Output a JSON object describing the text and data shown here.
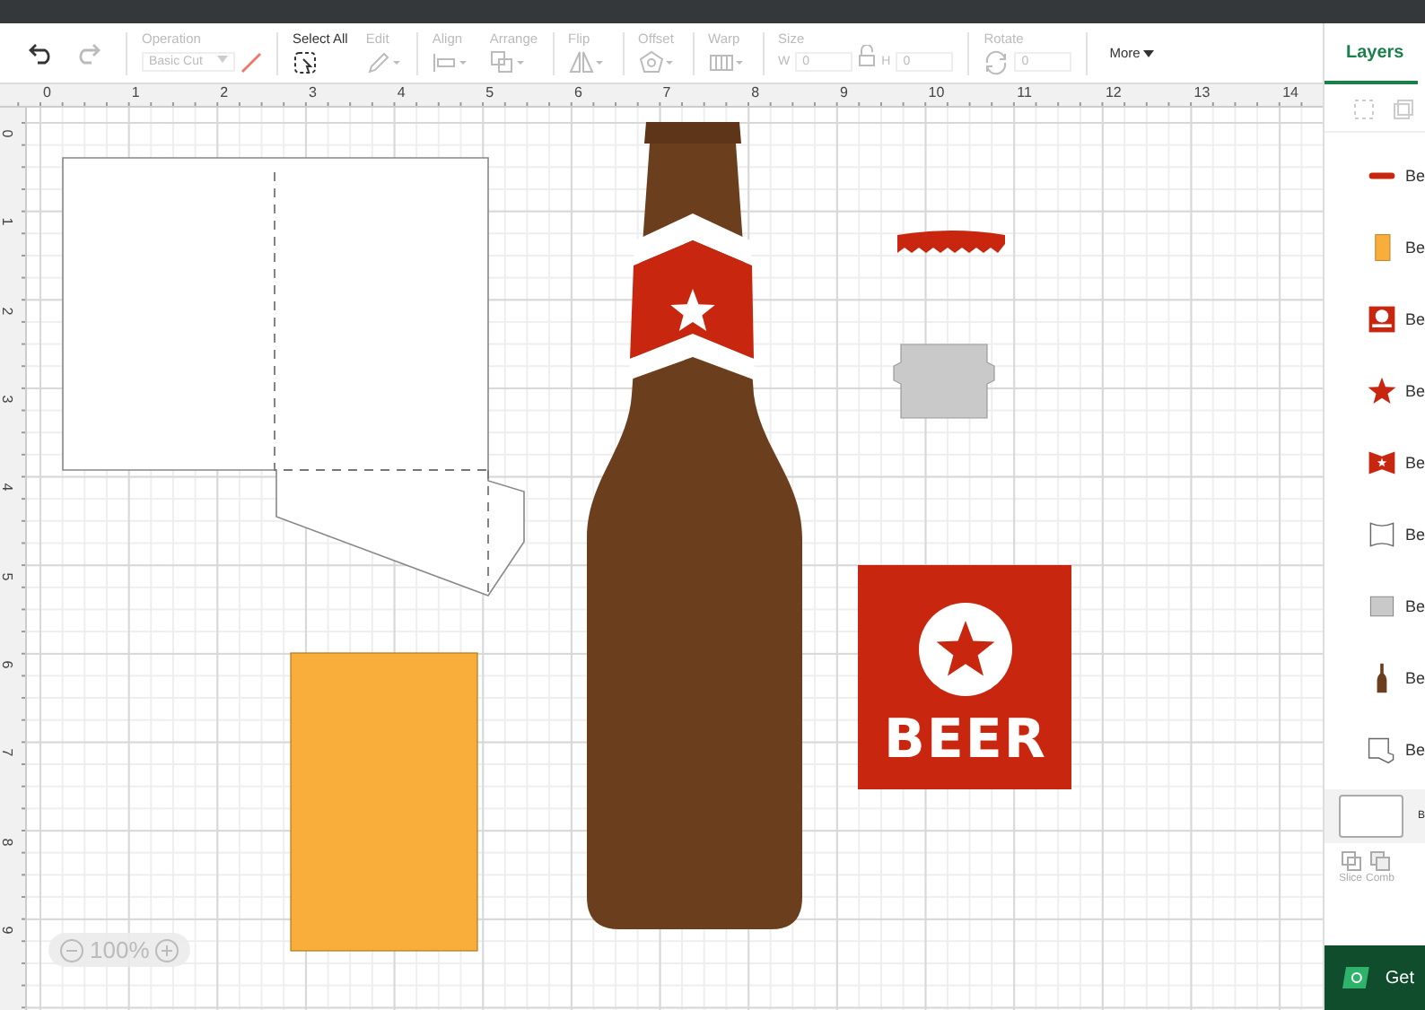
{
  "toolbar": {
    "undo": {
      "disabled": false
    },
    "redo": {
      "disabled": true
    },
    "sections": [
      [
        {
          "kind": "operation",
          "label": "Operation",
          "value": "Basic Cut",
          "disabled": true
        }
      ],
      [
        {
          "kind": "select-all",
          "label": "Select All",
          "disabled": false
        },
        {
          "kind": "edit",
          "label": "Edit",
          "disabled": true
        }
      ],
      [
        {
          "kind": "align",
          "label": "Align",
          "disabled": true
        },
        {
          "kind": "arrange",
          "label": "Arrange",
          "disabled": true
        }
      ],
      [
        {
          "kind": "flip",
          "label": "Flip",
          "disabled": true
        }
      ],
      [
        {
          "kind": "offset",
          "label": "Offset",
          "disabled": true
        }
      ],
      [
        {
          "kind": "warp",
          "label": "Warp",
          "disabled": true
        }
      ],
      [
        {
          "kind": "size",
          "label": "Size",
          "w_label": "W",
          "w_value": "0",
          "h_label": "H",
          "h_value": "0",
          "disabled": true
        }
      ],
      [
        {
          "kind": "rotate",
          "label": "Rotate",
          "value": "0",
          "disabled": true
        }
      ]
    ],
    "more": "More"
  },
  "ruler": {
    "x_labels": [
      "0",
      "1",
      "2",
      "3",
      "4",
      "5",
      "6",
      "7",
      "8",
      "9",
      "10",
      "11",
      "12",
      "13",
      "14"
    ],
    "y_labels": [
      "0",
      "1",
      "2",
      "3",
      "4",
      "5",
      "6",
      "7",
      "8",
      "9"
    ]
  },
  "canvas": {
    "beer_text": "BEER",
    "zoom": "100%"
  },
  "layers": {
    "tab": "Layers",
    "items": [
      {
        "kind": "cap",
        "label": "Be"
      },
      {
        "kind": "rectangle",
        "label": "Be"
      },
      {
        "kind": "sign",
        "label": "Be"
      },
      {
        "kind": "star",
        "label": "Be"
      },
      {
        "kind": "band",
        "label": "Be"
      },
      {
        "kind": "outline",
        "label": "Be"
      },
      {
        "kind": "plate",
        "label": "Be"
      },
      {
        "kind": "bottle",
        "label": "Be"
      },
      {
        "kind": "pocket",
        "label": "Be"
      }
    ],
    "canvas_item": "B",
    "actions": [
      {
        "kind": "slice",
        "label": "Slice"
      },
      {
        "kind": "combine",
        "label": "Comb"
      }
    ],
    "banner": "Get"
  }
}
